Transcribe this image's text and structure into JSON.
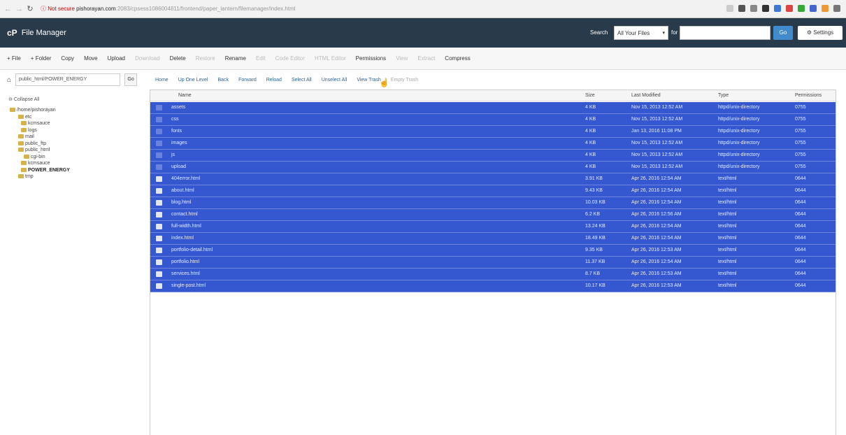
{
  "browser": {
    "url_host": "pishorayan.com",
    "url_prefix": "ⓘ Not secure",
    "url_rest": ":2083/cpsess1086004811/frontend/paper_lantern/filemanager/index.html"
  },
  "header": {
    "logo": "cP",
    "title": "File Manager",
    "search_label": "Search",
    "search_scope": "All Your Files",
    "for_label": "for",
    "go_label": "Go",
    "settings_label": "Settings"
  },
  "toolbar": [
    {
      "label": "+ File",
      "disabled": false
    },
    {
      "label": "+ Folder",
      "disabled": false
    },
    {
      "label": "Copy",
      "disabled": false
    },
    {
      "label": "Move",
      "disabled": false
    },
    {
      "label": "Upload",
      "disabled": false
    },
    {
      "label": "Download",
      "disabled": true
    },
    {
      "label": "Delete",
      "disabled": false
    },
    {
      "label": "Restore",
      "disabled": true
    },
    {
      "label": "Rename",
      "disabled": false
    },
    {
      "label": "Edit",
      "disabled": true
    },
    {
      "label": "Code Editor",
      "disabled": true
    },
    {
      "label": "HTML Editor",
      "disabled": true
    },
    {
      "label": "Permissions",
      "disabled": false
    },
    {
      "label": "View",
      "disabled": true
    },
    {
      "label": "Extract",
      "disabled": true
    },
    {
      "label": "Compress",
      "disabled": false
    }
  ],
  "path": {
    "value": "public_html/POWER_ENERGY",
    "go": "Go"
  },
  "actions": [
    {
      "label": "Home",
      "disabled": false
    },
    {
      "label": "Up One Level",
      "disabled": false
    },
    {
      "label": "Back",
      "disabled": false
    },
    {
      "label": "Forward",
      "disabled": false
    },
    {
      "label": "Reload",
      "disabled": false
    },
    {
      "label": "Select All",
      "disabled": false
    },
    {
      "label": "Unselect All",
      "disabled": false
    },
    {
      "label": "View Trash",
      "disabled": false
    },
    {
      "label": "Empty Trash",
      "disabled": true
    }
  ],
  "sidebar": {
    "collapse_label": "Collapse All",
    "tree": [
      {
        "label": "/home/pishorayan",
        "bold": false
      },
      {
        "label": "etc",
        "bold": false
      },
      {
        "label": "kcmsauce",
        "bold": false
      },
      {
        "label": "logs",
        "bold": false
      },
      {
        "label": "mail",
        "bold": false
      },
      {
        "label": "public_ftp",
        "bold": false
      },
      {
        "label": "public_html",
        "bold": false
      },
      {
        "label": "cgi-bin",
        "bold": false
      },
      {
        "label": "kcmsauce",
        "bold": false
      },
      {
        "label": "POWER_ENERGY",
        "bold": true
      },
      {
        "label": "tmp",
        "bold": false
      }
    ]
  },
  "columns": [
    "Name",
    "Size",
    "Last Modified",
    "Type",
    "Permissions"
  ],
  "files": [
    {
      "name": "assets",
      "size": "4 KB",
      "modified": "Nov 15, 2013 12:52 AM",
      "type": "httpd/unix-directory",
      "perms": "0755",
      "kind": "dir"
    },
    {
      "name": "css",
      "size": "4 KB",
      "modified": "Nov 15, 2013 12:52 AM",
      "type": "httpd/unix-directory",
      "perms": "0755",
      "kind": "dir"
    },
    {
      "name": "fonts",
      "size": "4 KB",
      "modified": "Jan 13, 2016 11:08 PM",
      "type": "httpd/unix-directory",
      "perms": "0755",
      "kind": "dir"
    },
    {
      "name": "images",
      "size": "4 KB",
      "modified": "Nov 15, 2013 12:52 AM",
      "type": "httpd/unix-directory",
      "perms": "0755",
      "kind": "dir"
    },
    {
      "name": "js",
      "size": "4 KB",
      "modified": "Nov 15, 2013 12:52 AM",
      "type": "httpd/unix-directory",
      "perms": "0755",
      "kind": "dir"
    },
    {
      "name": "upload",
      "size": "4 KB",
      "modified": "Nov 15, 2013 12:52 AM",
      "type": "httpd/unix-directory",
      "perms": "0755",
      "kind": "dir"
    },
    {
      "name": "404error.html",
      "size": "3.91 KB",
      "modified": "Apr 26, 2016 12:54 AM",
      "type": "text/html",
      "perms": "0644",
      "kind": "file"
    },
    {
      "name": "about.html",
      "size": "9.43 KB",
      "modified": "Apr 26, 2016 12:54 AM",
      "type": "text/html",
      "perms": "0644",
      "kind": "file"
    },
    {
      "name": "blog.html",
      "size": "10.03 KB",
      "modified": "Apr 26, 2016 12:54 AM",
      "type": "text/html",
      "perms": "0644",
      "kind": "file"
    },
    {
      "name": "contact.html",
      "size": "6.2 KB",
      "modified": "Apr 26, 2016 12:56 AM",
      "type": "text/html",
      "perms": "0644",
      "kind": "file"
    },
    {
      "name": "full-width.html",
      "size": "13.24 KB",
      "modified": "Apr 26, 2016 12:54 AM",
      "type": "text/html",
      "perms": "0644",
      "kind": "file"
    },
    {
      "name": "index.html",
      "size": "18.49 KB",
      "modified": "Apr 26, 2016 12:54 AM",
      "type": "text/html",
      "perms": "0644",
      "kind": "file"
    },
    {
      "name": "portfolio-detail.html",
      "size": "9.35 KB",
      "modified": "Apr 26, 2016 12:53 AM",
      "type": "text/html",
      "perms": "0644",
      "kind": "file"
    },
    {
      "name": "portfolio.html",
      "size": "11.37 KB",
      "modified": "Apr 26, 2016 12:54 AM",
      "type": "text/html",
      "perms": "0644",
      "kind": "file"
    },
    {
      "name": "services.html",
      "size": "8.7 KB",
      "modified": "Apr 26, 2016 12:53 AM",
      "type": "text/html",
      "perms": "0644",
      "kind": "file"
    },
    {
      "name": "single-post.html",
      "size": "10.17 KB",
      "modified": "Apr 26, 2016 12:53 AM",
      "type": "text/html",
      "perms": "0644",
      "kind": "file"
    }
  ],
  "colors": {
    "header_bg": "#293a4a",
    "selected_row": "#3558d1",
    "link": "#2a6496"
  }
}
